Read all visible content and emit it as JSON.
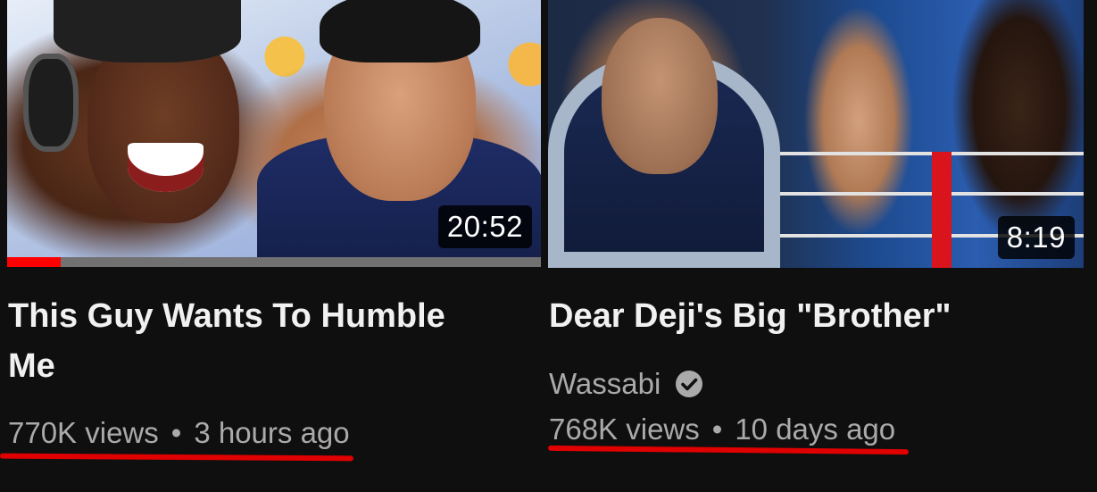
{
  "videos": [
    {
      "title": "This Guy Wants To Humble Me",
      "duration": "20:52",
      "views": "770K views",
      "age": "3 hours ago",
      "watch_progress": 0.1,
      "thumbnail_desc": "Two people reacting, one laughing with headphones, one shocked, emoji background"
    },
    {
      "title": "Dear Deji's Big \"Brother\"",
      "channel": "Wassabi",
      "channel_verified": true,
      "duration": "8:19",
      "views": "768K views",
      "age": "10 days ago",
      "thumbnail_desc": "Close-up face on left, boxing match in a ring on right"
    }
  ],
  "colors": {
    "background": "#0f0f0f",
    "title_text": "#f1f1f1",
    "meta_text": "#aaaaaa",
    "progress": "#ff0000",
    "annotation_underline": "#e00000"
  },
  "separator": "•",
  "icons": {
    "verified": "verified-check-icon"
  }
}
